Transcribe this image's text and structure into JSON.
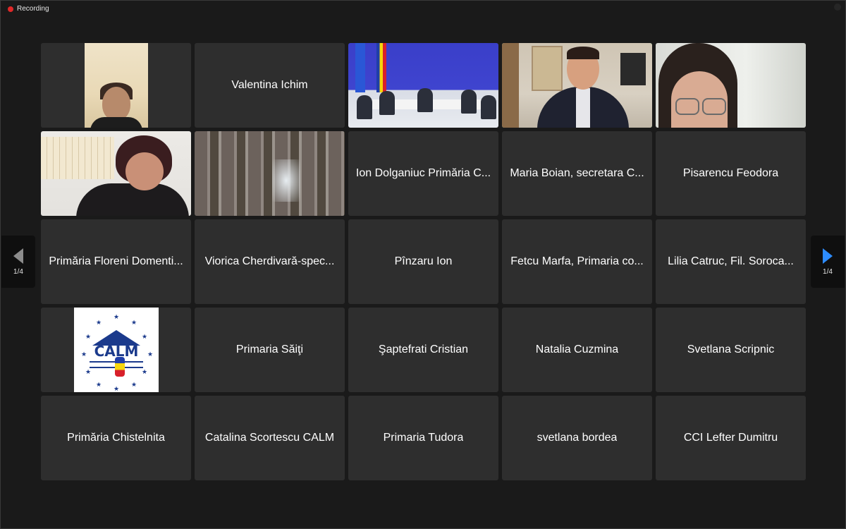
{
  "recording": {
    "label": "Recording"
  },
  "pager": {
    "left_indicator": "1/4",
    "right_indicator": "1/4"
  },
  "colors": {
    "active_speaker_border": "#23c552",
    "next_arrow": "#2d8cff",
    "record_dot": "#e02828"
  },
  "participants": [
    {
      "name": "",
      "video": "woman-yellow-wall"
    },
    {
      "name": "Valentina Ichim"
    },
    {
      "name": "",
      "video": "conference-room-flags"
    },
    {
      "name": "",
      "video": "man-in-office",
      "active": true
    },
    {
      "name": "",
      "video": "woman-with-glasses"
    },
    {
      "name": "",
      "video": "woman-calendar-wall"
    },
    {
      "name": "",
      "video": "window-blinds"
    },
    {
      "name": "Ion Dolganiuc Primăria C..."
    },
    {
      "name": "Maria Boian, secretara C..."
    },
    {
      "name": "Pisarencu Feodora"
    },
    {
      "name": "Primăria Floreni Domenti..."
    },
    {
      "name": "Viorica Cherdivară-spec..."
    },
    {
      "name": "Pînzaru Ion"
    },
    {
      "name": "Fetcu Marfa, Primaria co..."
    },
    {
      "name": "Lilia  Catruc, Fil. Soroca..."
    },
    {
      "name": "",
      "video": "calm-logo",
      "logo_text": "CALM"
    },
    {
      "name": "Primaria Săiţi"
    },
    {
      "name": "Şaptefrati Cristian"
    },
    {
      "name": "Natalia Cuzmina"
    },
    {
      "name": "Svetlana Scripnic"
    },
    {
      "name": "Primăria Chistelnita"
    },
    {
      "name": "Catalina Scortescu CALM"
    },
    {
      "name": "Primaria Tudora"
    },
    {
      "name": "svetlana bordea"
    },
    {
      "name": "CCI  Lefter Dumitru"
    }
  ]
}
